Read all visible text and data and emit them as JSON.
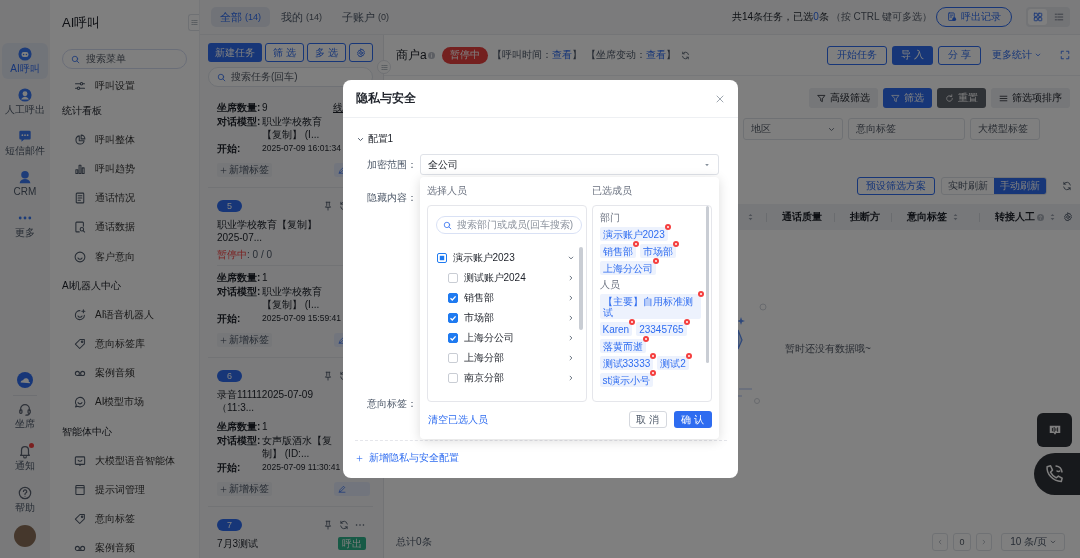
{
  "rail": {
    "items": [
      {
        "label": "AI呼叫",
        "selected": true
      },
      {
        "label": "人工呼出",
        "selected": false
      },
      {
        "label": "短信邮件",
        "selected": false
      },
      {
        "label": "CRM",
        "selected": false
      },
      {
        "label": "更多",
        "selected": false
      }
    ],
    "bottom_items": [
      {
        "label": "坐席",
        "unread": false
      },
      {
        "label": "通知",
        "unread": true
      },
      {
        "label": "帮助",
        "unread": false
      }
    ]
  },
  "menu": {
    "title": "AI呼叫",
    "search": {
      "placeholder": "搜索菜单"
    },
    "sections": [
      {
        "items": [
          "呼叫设置"
        ]
      },
      {
        "heading": "统计看板",
        "items": [
          "呼叫整体",
          "呼叫趋势",
          "通话情况",
          "通话数据",
          "客户意向"
        ]
      },
      {
        "heading": "AI机器人中心",
        "items": [
          "AI语音机器人",
          "意向标签库",
          "案例音频",
          "AI模型市场"
        ]
      },
      {
        "heading": "智能体中心",
        "items": [
          "大模型语音智能体",
          "提示词管理",
          "意向标签",
          "案例音频"
        ]
      }
    ]
  },
  "top_bar": {
    "tabs": [
      {
        "label": "全部",
        "count": "(14)",
        "selected": true
      },
      {
        "label": "我的",
        "count": "(14)",
        "selected": false
      },
      {
        "label": "子账户",
        "count": "(0)",
        "selected": false
      }
    ],
    "summary": {
      "prefix": "共14条任务，已选",
      "count": "0",
      "suffix": "条"
    },
    "hint": "（按 CTRL 键可多选）",
    "record_button": "呼出记录",
    "view_toggle": [
      {
        "selected": true
      },
      {
        "selected": false
      }
    ]
  },
  "task_panel": {
    "buttons": [
      {
        "label": "新建任务",
        "kind": "primary"
      },
      {
        "label": "筛 选",
        "kind": "outline"
      },
      {
        "label": "多 选",
        "kind": "outline"
      },
      {
        "kind": "settings"
      }
    ],
    "search": {
      "placeholder": "搜索任务(回车)"
    },
    "tasks": [
      {
        "fields": [
          {
            "label": "坐席数量:",
            "value": "9",
            "link": "线"
          },
          {
            "label": "对话模型:",
            "value": "职业学校教育【复制】 (I..."
          },
          {
            "label": "开始:",
            "value": "2025-07-09 16:01:34"
          }
        ],
        "add_tag": "新增标签"
      },
      {
        "number": "5",
        "title": "职业学校教育【复制】2025-07...",
        "status": {
          "label": "暂停中",
          "progress": ": 0 / 0"
        },
        "fields": [
          {
            "label": "坐席数量:",
            "value": "1"
          },
          {
            "label": "对话模型:",
            "value": "职业学校教育【复制】 (I..."
          },
          {
            "label": "开始:",
            "value": "2025-07-09 15:59:41"
          }
        ],
        "add_tag": "新增标签"
      },
      {
        "number": "6",
        "title": "录音111112025-07-09（11:3...",
        "fields": [
          {
            "label": "坐席数量:",
            "value": "1"
          },
          {
            "label": "对话模型:",
            "value": "女声版酒水【复制】 (ID:..."
          },
          {
            "label": "开始:",
            "value": "2025-07-09 11:30:41"
          }
        ],
        "add_tag": "新增标签"
      },
      {
        "number": "7",
        "title": "7月3测试",
        "tag": "呼出"
      }
    ]
  },
  "main": {
    "header": {
      "title": "商户a",
      "status": "暂停中",
      "meta": [
        {
          "prefix": "【呼叫时间：",
          "link": "查看",
          "suffix": "】"
        },
        {
          "prefix": "【坐席变动：",
          "link": "查看",
          "suffix": "】"
        }
      ],
      "actions": [
        {
          "label": "开始任务",
          "kind": "outline"
        },
        {
          "label": "导 入",
          "kind": "primary"
        },
        {
          "label": "分 享",
          "kind": "outline"
        },
        {
          "label": "更多统计",
          "kind": "dropdown"
        }
      ]
    },
    "filter_buttons": [
      {
        "label": "高级筛选",
        "kind": "light"
      },
      {
        "label": "筛选",
        "kind": "primary"
      },
      {
        "label": "重置",
        "kind": "dark"
      },
      {
        "label": "筛选项排序",
        "kind": "light"
      }
    ],
    "filters": [
      {
        "placeholder": "地区",
        "kind": "select"
      },
      {
        "placeholder": "意向标签",
        "kind": "input"
      },
      {
        "placeholder": "大模型标签",
        "kind": "input"
      }
    ],
    "preset_button": "预设筛选方案",
    "refresh_modes": [
      {
        "label": "实时刷新",
        "selected": false
      },
      {
        "label": "手动刷新",
        "selected": true
      }
    ],
    "table": {
      "columns": [
        {
          "sortable": true,
          "help": false
        },
        {
          "label": "通话质量",
          "sortable": false,
          "help": false
        },
        {
          "label": "挂断方",
          "sortable": false,
          "help": false
        },
        {
          "label": "意向标签",
          "sortable": true,
          "help": false
        },
        {
          "label": "转接人工",
          "sortable": true,
          "help": true
        }
      ],
      "empty_text": "暂时还没有数据哦~"
    },
    "footer": {
      "total": "总计0条",
      "page": "0",
      "page_size": "10 条/页"
    }
  },
  "modal": {
    "title": "隐私与安全",
    "config": {
      "title": "配置1",
      "expanded": true,
      "fields": [
        {
          "label": "加密范围：",
          "value": "全公司"
        },
        {
          "label": "隐藏内容："
        },
        {
          "label": "意向标签："
        }
      ]
    },
    "picker": {
      "source_title": "选择人员",
      "selected_title": "已选成员",
      "search": {
        "placeholder": "搜索部门或成员(回车搜索)"
      },
      "tree": [
        {
          "label": "演示账户2023",
          "checked": false,
          "indeterminate": true,
          "expanded": true,
          "children": [
            {
              "label": "测试账户2024",
              "checked": false,
              "indeterminate": false,
              "expanded": false
            },
            {
              "label": "销售部",
              "checked": true,
              "indeterminate": false,
              "expanded": false
            },
            {
              "label": "市场部",
              "checked": true,
              "indeterminate": false,
              "expanded": false
            },
            {
              "label": "上海分公司",
              "checked": true,
              "indeterminate": false,
              "expanded": false
            },
            {
              "label": "上海分部",
              "checked": false,
              "indeterminate": false,
              "expanded": false
            },
            {
              "label": "南京分部",
              "checked": false,
              "indeterminate": false,
              "expanded": false
            }
          ]
        }
      ],
      "selected_groups": [
        {
          "heading": "部门",
          "tags": [
            "演示账户2023",
            "销售部",
            "市场部",
            "上海分公司"
          ]
        },
        {
          "heading": "人员",
          "tags": [
            "【主要】自用标准测试",
            "Karen",
            "23345765",
            "落黄而逝",
            "测试33333",
            "测试2",
            "st演示小号"
          ]
        }
      ],
      "clear_link": "清空已选人员",
      "buttons": [
        {
          "label": "取 消",
          "kind": "default"
        },
        {
          "label": "确 认",
          "kind": "primary"
        }
      ]
    },
    "add_config": "新增隐私与安全配置"
  }
}
